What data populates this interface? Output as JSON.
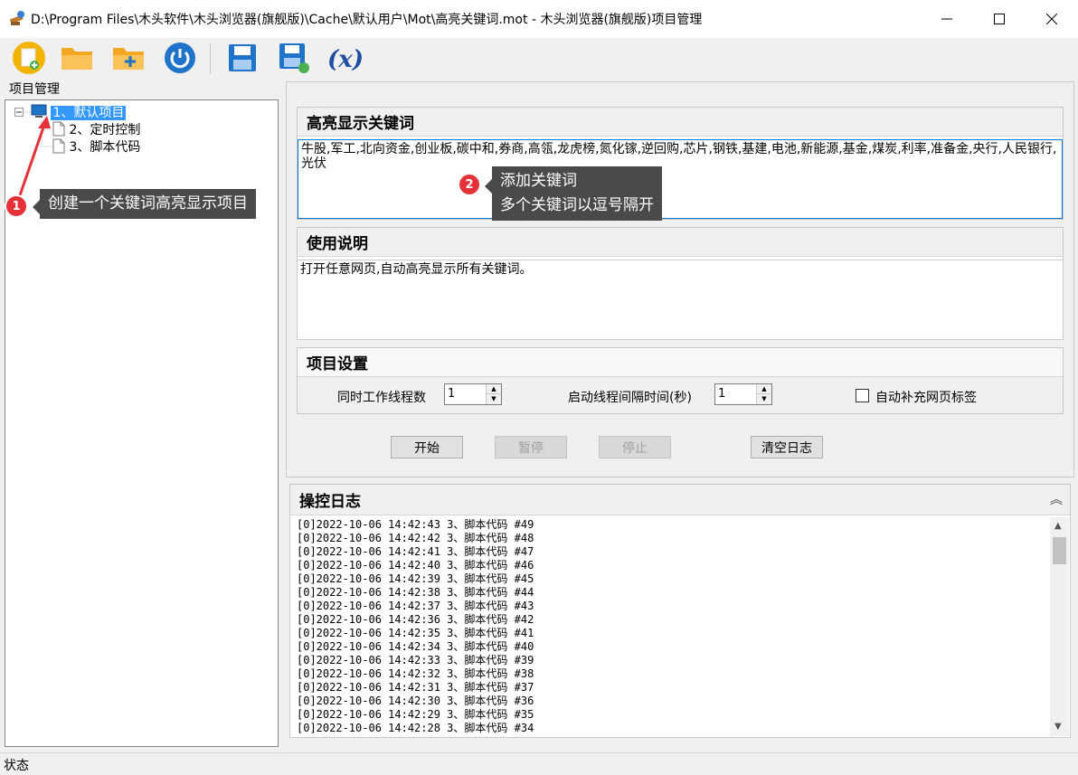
{
  "window": {
    "title": "D:\\Program Files\\木头软件\\木头浏览器(旗舰版)\\Cache\\默认用户\\Mot\\高亮关键词.mot  - 木头浏览器(旗舰版)项目管理"
  },
  "toolbar": {
    "buttons": [
      "new-file-icon",
      "open-folder-icon",
      "add-folder-icon",
      "power-icon",
      "save-icon",
      "save-as-icon",
      "variable-icon"
    ],
    "variable_label": "(x)"
  },
  "left": {
    "label": "项目管理",
    "tree": [
      {
        "label": "1、默认项目",
        "selected": true
      },
      {
        "label": "2、定时控制",
        "selected": false
      },
      {
        "label": "3、脚本代码",
        "selected": false
      }
    ]
  },
  "annotations": {
    "one": {
      "num": "1",
      "text": "创建一个关键词高亮显示项目"
    },
    "two": {
      "num": "2",
      "line1": "添加关键词",
      "line2": "多个关键词以逗号隔开"
    }
  },
  "keywords_panel": {
    "title": "高亮显示关键词",
    "value": "牛股,军工,北向资金,创业板,碳中和,券商,高瓴,龙虎榜,氮化镓,逆回购,芯片,钢铁,基建,电池,新能源,基金,煤炭,利率,准备金,央行,人民银行,光伏"
  },
  "usage_panel": {
    "title": "使用说明",
    "value": "打开任意网页,自动高亮显示所有关键词。"
  },
  "settings_panel": {
    "title": "项目设置",
    "threads_label": "同时工作线程数",
    "threads_value": "1",
    "interval_label": "启动线程间隔时间(秒)",
    "interval_value": "1",
    "autofill_label": "自动补充网页标签",
    "autofill_checked": false
  },
  "actions": {
    "start": "开始",
    "pause": "暂停",
    "stop": "停止",
    "clear": "清空日志"
  },
  "log_panel": {
    "title": "操控日志",
    "collapse_glyph": "︽",
    "lines": [
      "[0]2022-10-06 14:42:43 3、脚本代码 #49",
      "[0]2022-10-06 14:42:42 3、脚本代码 #48",
      "[0]2022-10-06 14:42:41 3、脚本代码 #47",
      "[0]2022-10-06 14:42:40 3、脚本代码 #46",
      "[0]2022-10-06 14:42:39 3、脚本代码 #45",
      "[0]2022-10-06 14:42:38 3、脚本代码 #44",
      "[0]2022-10-06 14:42:37 3、脚本代码 #43",
      "[0]2022-10-06 14:42:36 3、脚本代码 #42",
      "[0]2022-10-06 14:42:35 3、脚本代码 #41",
      "[0]2022-10-06 14:42:34 3、脚本代码 #40",
      "[0]2022-10-06 14:42:33 3、脚本代码 #39",
      "[0]2022-10-06 14:42:32 3、脚本代码 #38",
      "[0]2022-10-06 14:42:31 3、脚本代码 #37",
      "[0]2022-10-06 14:42:30 3、脚本代码 #36",
      "[0]2022-10-06 14:42:29 3、脚本代码 #35",
      "[0]2022-10-06 14:42:28 3、脚本代码 #34"
    ]
  },
  "status": {
    "label": "状态"
  },
  "colors": {
    "selection": "#3399ff",
    "callout": "#4a4a4a",
    "badge": "#e53238",
    "focus_border": "#0078d7"
  }
}
